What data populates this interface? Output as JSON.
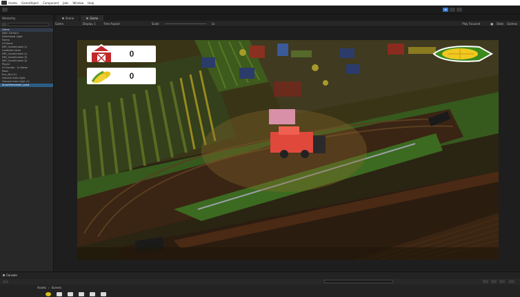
{
  "menubar": {
    "items": [
      "Assets",
      "GameObject",
      "Component",
      "Jobs",
      "Window",
      "Help"
    ]
  },
  "hierarchy": {
    "title": "Hierarchy",
    "items": [
      {
        "label": "Game",
        "kind": "scene"
      },
      {
        "label": "Main Camera",
        "kind": "row"
      },
      {
        "label": "Directional Light",
        "kind": "row"
      },
      {
        "label": "Farms",
        "kind": "row"
      },
      {
        "label": "UI Farms",
        "kind": "row"
      },
      {
        "label": "NPC_ScaleCrowd (1)",
        "kind": "row"
      },
      {
        "label": "Collection Area",
        "kind": "row"
      },
      {
        "label": "NPC_ScaleCrowd (1)",
        "kind": "row"
      },
      {
        "label": "NPC_ScaleCrowd (3)",
        "kind": "row"
      },
      {
        "label": "NPC_ScaleCrowd (2)",
        "kind": "row"
      },
      {
        "label": "Player",
        "kind": "row"
      },
      {
        "label": "UI Canvas - In Game",
        "kind": "row"
      },
      {
        "label": "Mass",
        "kind": "row"
      },
      {
        "label": "Env_Dirt (1)",
        "kind": "row"
      },
      {
        "label": "Harvest Area Light",
        "kind": "row"
      },
      {
        "label": "Harvest Area Light (1)",
        "kind": "row"
      },
      {
        "label": "SmartHarvester_Load",
        "kind": "sel"
      }
    ]
  },
  "game_tabs": {
    "scene": "Scene",
    "game": "Game"
  },
  "game_options": {
    "view": "Game",
    "display": "Display 1",
    "aspect": "Free Aspect",
    "scale_label": "Scale",
    "scale_value": "1x",
    "play_focused": "Play Focused",
    "stats": "Stats",
    "gizmos": "Gizmos"
  },
  "hud": {
    "barn_count": "0",
    "corn_count": "0",
    "barn_icon": "barn-icon",
    "corn_icon": "corn-icon"
  },
  "console": {
    "tab": "Console",
    "breadcrumb": [
      "Assets",
      "Scenes"
    ]
  },
  "colors": {
    "play_blue": "#3b7bd8",
    "grass": "#3b6e22",
    "dirt": "#3a2414",
    "harvester": "#e0483c"
  }
}
